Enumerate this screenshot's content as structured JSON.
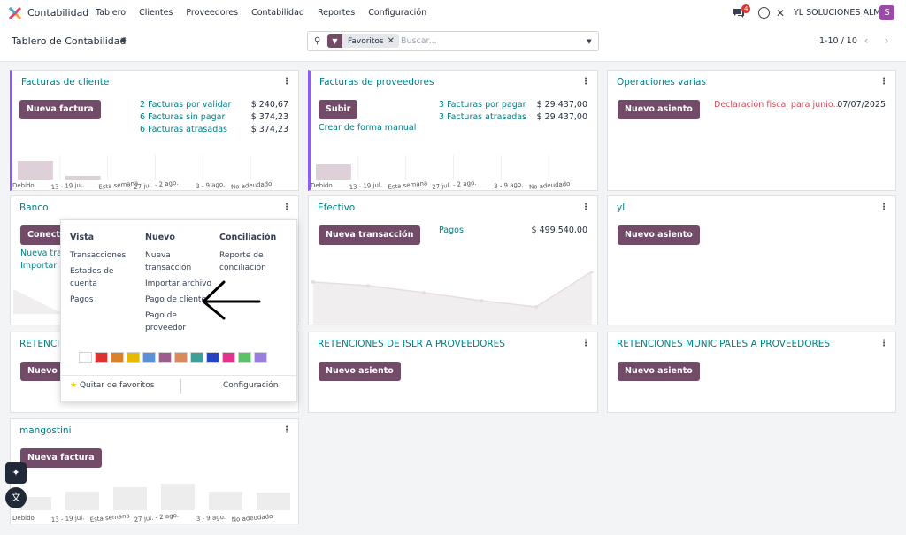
{
  "topbar": {
    "app_title": "Contabilidad",
    "menu": [
      "Tablero",
      "Clientes",
      "Proveedores",
      "Contabilidad",
      "Reportes",
      "Configuración"
    ],
    "chat_count": "4",
    "company": "YL SOLUCIONES ALM",
    "avatar_letter": "S"
  },
  "control": {
    "page_title": "Tablero de Contabilidad",
    "facet_label": "Favoritos",
    "search_placeholder": "Buscar...",
    "pager": "1-10 / 10"
  },
  "charts_axis_labels": [
    "Debido",
    "13 - 19 jul.",
    "Esta semana",
    "27 jul. - 2 ago.",
    "3 - 9 ago.",
    "No adeudado"
  ],
  "cards": {
    "facturas_cliente": {
      "title": "Facturas de cliente",
      "button": "Nueva factura",
      "links": [
        "2 Facturas por validar",
        "6 Facturas sin pagar",
        "6 Facturas atrasadas"
      ],
      "amounts": [
        "$ 240,67",
        "$ 374,23",
        "$ 374,23"
      ]
    },
    "facturas_proveedores": {
      "title": "Facturas de proveedores",
      "button": "Subir",
      "links": [
        "3 Facturas por pagar",
        "3 Facturas atrasadas"
      ],
      "amounts": [
        "$ 29.437,00",
        "$ 29.437,00"
      ],
      "manual": "Crear de forma manual"
    },
    "operaciones_varias": {
      "title": "Operaciones varias",
      "button": "Nuevo asiento",
      "item": "Declaración fiscal para junio...",
      "date": "07/07/2025"
    },
    "banco": {
      "title": "Banco",
      "button": "Conectar",
      "links": [
        "Nueva tran",
        "Importar ar"
      ]
    },
    "efectivo": {
      "title": "Efectivo",
      "button": "Nueva transacción",
      "link": "Pagos",
      "amount": "$ 499.540,00"
    },
    "yl": {
      "title": "yl",
      "button": "Nuevo asiento"
    },
    "retenciones_cut": {
      "title": "RETENCIO",
      "button": "Nuevo asi"
    },
    "retenciones_islr": {
      "title": "RETENCIONES DE ISLR A PROVEEDORES",
      "button": "Nuevo asiento"
    },
    "retenciones_municipales": {
      "title": "RETENCIONES MUNICIPALES A PROVEEDORES",
      "button": "Nuevo asiento"
    },
    "mangostini": {
      "title": "mangostini",
      "button": "Nueva factura"
    }
  },
  "popup": {
    "vista": {
      "heading": "Vista",
      "items": [
        "Transacciones",
        "Estados de cuenta",
        "Pagos"
      ]
    },
    "nuevo": {
      "heading": "Nuevo",
      "items": [
        "Nueva transacción",
        "Importar archivo",
        "Pago de cliente",
        "Pago de proveedor"
      ]
    },
    "conciliacion": {
      "heading": "Conciliación",
      "items": [
        "Reporte de conciliación"
      ]
    },
    "colors": [
      "#ffffff",
      "#e03131",
      "#d9822b",
      "#e6b800",
      "#5b8fd6",
      "#9b5d8e",
      "#d98a5c",
      "#3f9e96",
      "#2743c4",
      "#e0368a",
      "#5fc06a",
      "#9b7de0"
    ],
    "favorite_label": "Quitar de favoritos",
    "config_label": "Configuración"
  }
}
